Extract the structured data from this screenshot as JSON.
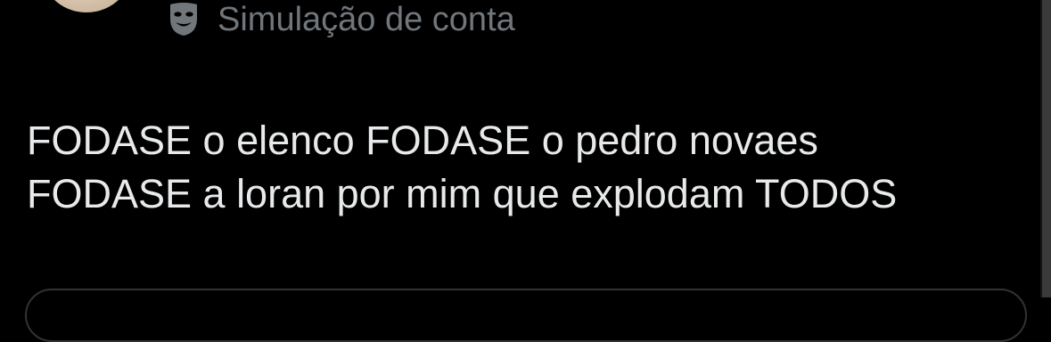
{
  "post": {
    "label": "Simulação de conta",
    "label_icon": "theater-mask-icon",
    "text": "FODASE o elenco FODASE o pedro novaes\nFODASE a loran por mim que explodam TODOS"
  },
  "colors": {
    "background": "#000000",
    "text": "#e7e9ea",
    "secondary_text": "#71767b",
    "border": "#2f3336"
  }
}
